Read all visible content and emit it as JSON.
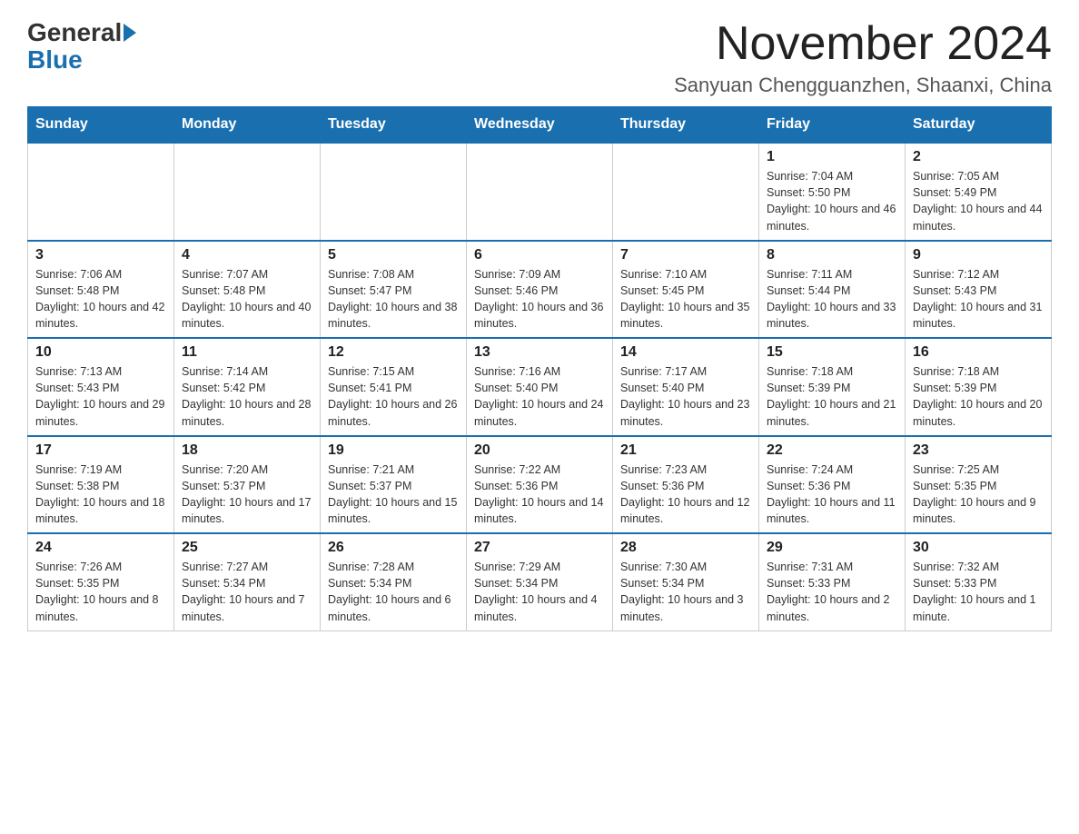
{
  "header": {
    "logo_general": "General",
    "logo_blue": "Blue",
    "month_title": "November 2024",
    "location": "Sanyuan Chengguanzhen, Shaanxi, China"
  },
  "weekdays": [
    "Sunday",
    "Monday",
    "Tuesday",
    "Wednesday",
    "Thursday",
    "Friday",
    "Saturday"
  ],
  "weeks": [
    [
      {
        "day": "",
        "info": ""
      },
      {
        "day": "",
        "info": ""
      },
      {
        "day": "",
        "info": ""
      },
      {
        "day": "",
        "info": ""
      },
      {
        "day": "",
        "info": ""
      },
      {
        "day": "1",
        "info": "Sunrise: 7:04 AM\nSunset: 5:50 PM\nDaylight: 10 hours and 46 minutes."
      },
      {
        "day": "2",
        "info": "Sunrise: 7:05 AM\nSunset: 5:49 PM\nDaylight: 10 hours and 44 minutes."
      }
    ],
    [
      {
        "day": "3",
        "info": "Sunrise: 7:06 AM\nSunset: 5:48 PM\nDaylight: 10 hours and 42 minutes."
      },
      {
        "day": "4",
        "info": "Sunrise: 7:07 AM\nSunset: 5:48 PM\nDaylight: 10 hours and 40 minutes."
      },
      {
        "day": "5",
        "info": "Sunrise: 7:08 AM\nSunset: 5:47 PM\nDaylight: 10 hours and 38 minutes."
      },
      {
        "day": "6",
        "info": "Sunrise: 7:09 AM\nSunset: 5:46 PM\nDaylight: 10 hours and 36 minutes."
      },
      {
        "day": "7",
        "info": "Sunrise: 7:10 AM\nSunset: 5:45 PM\nDaylight: 10 hours and 35 minutes."
      },
      {
        "day": "8",
        "info": "Sunrise: 7:11 AM\nSunset: 5:44 PM\nDaylight: 10 hours and 33 minutes."
      },
      {
        "day": "9",
        "info": "Sunrise: 7:12 AM\nSunset: 5:43 PM\nDaylight: 10 hours and 31 minutes."
      }
    ],
    [
      {
        "day": "10",
        "info": "Sunrise: 7:13 AM\nSunset: 5:43 PM\nDaylight: 10 hours and 29 minutes."
      },
      {
        "day": "11",
        "info": "Sunrise: 7:14 AM\nSunset: 5:42 PM\nDaylight: 10 hours and 28 minutes."
      },
      {
        "day": "12",
        "info": "Sunrise: 7:15 AM\nSunset: 5:41 PM\nDaylight: 10 hours and 26 minutes."
      },
      {
        "day": "13",
        "info": "Sunrise: 7:16 AM\nSunset: 5:40 PM\nDaylight: 10 hours and 24 minutes."
      },
      {
        "day": "14",
        "info": "Sunrise: 7:17 AM\nSunset: 5:40 PM\nDaylight: 10 hours and 23 minutes."
      },
      {
        "day": "15",
        "info": "Sunrise: 7:18 AM\nSunset: 5:39 PM\nDaylight: 10 hours and 21 minutes."
      },
      {
        "day": "16",
        "info": "Sunrise: 7:18 AM\nSunset: 5:39 PM\nDaylight: 10 hours and 20 minutes."
      }
    ],
    [
      {
        "day": "17",
        "info": "Sunrise: 7:19 AM\nSunset: 5:38 PM\nDaylight: 10 hours and 18 minutes."
      },
      {
        "day": "18",
        "info": "Sunrise: 7:20 AM\nSunset: 5:37 PM\nDaylight: 10 hours and 17 minutes."
      },
      {
        "day": "19",
        "info": "Sunrise: 7:21 AM\nSunset: 5:37 PM\nDaylight: 10 hours and 15 minutes."
      },
      {
        "day": "20",
        "info": "Sunrise: 7:22 AM\nSunset: 5:36 PM\nDaylight: 10 hours and 14 minutes."
      },
      {
        "day": "21",
        "info": "Sunrise: 7:23 AM\nSunset: 5:36 PM\nDaylight: 10 hours and 12 minutes."
      },
      {
        "day": "22",
        "info": "Sunrise: 7:24 AM\nSunset: 5:36 PM\nDaylight: 10 hours and 11 minutes."
      },
      {
        "day": "23",
        "info": "Sunrise: 7:25 AM\nSunset: 5:35 PM\nDaylight: 10 hours and 9 minutes."
      }
    ],
    [
      {
        "day": "24",
        "info": "Sunrise: 7:26 AM\nSunset: 5:35 PM\nDaylight: 10 hours and 8 minutes."
      },
      {
        "day": "25",
        "info": "Sunrise: 7:27 AM\nSunset: 5:34 PM\nDaylight: 10 hours and 7 minutes."
      },
      {
        "day": "26",
        "info": "Sunrise: 7:28 AM\nSunset: 5:34 PM\nDaylight: 10 hours and 6 minutes."
      },
      {
        "day": "27",
        "info": "Sunrise: 7:29 AM\nSunset: 5:34 PM\nDaylight: 10 hours and 4 minutes."
      },
      {
        "day": "28",
        "info": "Sunrise: 7:30 AM\nSunset: 5:34 PM\nDaylight: 10 hours and 3 minutes."
      },
      {
        "day": "29",
        "info": "Sunrise: 7:31 AM\nSunset: 5:33 PM\nDaylight: 10 hours and 2 minutes."
      },
      {
        "day": "30",
        "info": "Sunrise: 7:32 AM\nSunset: 5:33 PM\nDaylight: 10 hours and 1 minute."
      }
    ]
  ]
}
